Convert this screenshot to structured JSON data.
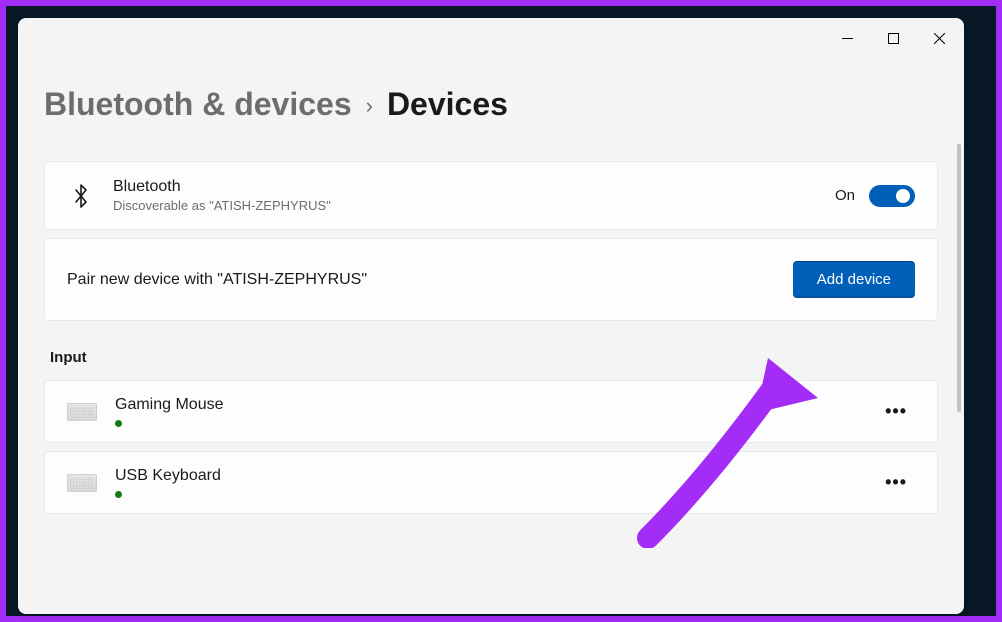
{
  "breadcrumb": {
    "parent": "Bluetooth & devices",
    "current": "Devices"
  },
  "bluetooth": {
    "title": "Bluetooth",
    "subtitle": "Discoverable as \"ATISH-ZEPHYRUS\"",
    "state_label": "On"
  },
  "pair": {
    "text": "Pair new device with \"ATISH-ZEPHYRUS\"",
    "button": "Add device"
  },
  "sections": {
    "input": {
      "label": "Input",
      "devices": [
        {
          "name": "Gaming Mouse",
          "status_color": "#107c10"
        },
        {
          "name": "USB Keyboard",
          "status_color": "#107c10"
        }
      ]
    }
  },
  "colors": {
    "accent": "#005fb8",
    "annotation": "#a32df7"
  }
}
